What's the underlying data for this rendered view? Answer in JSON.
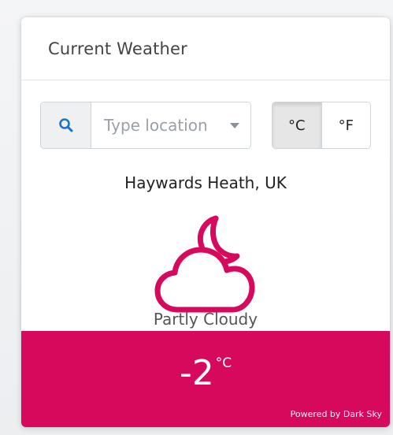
{
  "header": {
    "title": "Current Weather"
  },
  "search": {
    "icon": "search-icon",
    "placeholder": "Type location"
  },
  "units": {
    "celsius_label": "°C",
    "fahrenheit_label": "°F",
    "selected": "°C"
  },
  "weather": {
    "location": "Haywards Heath, UK",
    "icon": "partly-cloudy-night-icon",
    "condition": "Partly Cloudy",
    "temperature": "-2",
    "temperature_unit": "°C",
    "accent_color": "#d6095d"
  },
  "footer": {
    "powered_by": "Powered by Dark Sky"
  }
}
